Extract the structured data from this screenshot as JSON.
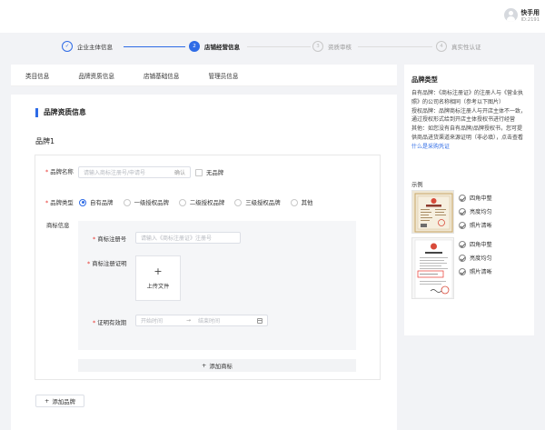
{
  "user": {
    "name": "快手用",
    "id": "ID:2191"
  },
  "steps": [
    {
      "num": "✓",
      "label": "企业主体信息",
      "state": "done"
    },
    {
      "num": "2",
      "label": "店铺经营信息",
      "state": "active"
    },
    {
      "num": "3",
      "label": "资质审核",
      "state": "todo"
    },
    {
      "num": "4",
      "label": "真实性认证",
      "state": "todo"
    }
  ],
  "tabs": [
    "类目信息",
    "品牌资质信息",
    "店铺基础信息",
    "管理员信息"
  ],
  "section_title": "品牌资质信息",
  "brand_title": "品牌1",
  "form": {
    "brand_name_label": "品牌名称",
    "brand_name_placeholder": "请输入商标注册号/申请号",
    "confirm_label": "确认",
    "no_brand_label": "无品牌",
    "brand_type_label": "品牌类型",
    "brand_type_options": [
      "自有品牌",
      "一级授权品牌",
      "二级授权品牌",
      "三级授权品牌",
      "其他"
    ],
    "brand_type_selected": "自有品牌",
    "trademark_info_label": "商标信息",
    "trademark_no_label": "商标注册号",
    "trademark_no_placeholder": "请输入《商标注册证》注册号",
    "trademark_cert_label": "商标注册证明",
    "upload_label": "上传文件",
    "validity_label": "证明有效期",
    "date_start_placeholder": "开始时间",
    "date_sep": "→",
    "date_end_placeholder": "结束时间",
    "add_trademark_label": "添加商标",
    "add_brand_label": "添加品牌"
  },
  "side": {
    "title": "品牌类型",
    "own_brand": "自有品牌：《商标注册证》的注册人与《营业执照》的公司名称相同（参考以下图片）",
    "authorized_brand": "授权品牌：品牌商标注册人与开店主体不一致，通过授权形式给到开店主体授权书进行经营",
    "other_text": "其他：如您没有自有品牌/品牌授权书，您可提供商品进货渠道来源证明（非必填），点击查看",
    "other_link": "什么是采购凭证",
    "example_label": "示例",
    "example1_checks": [
      "四角中整",
      "亮度均匀",
      "照片清晰"
    ],
    "example2_checks": [
      "四角中整",
      "亮度均匀",
      "照片清晰"
    ]
  },
  "colors": {
    "accent": "#2e6be6",
    "required": "#e8342d"
  }
}
